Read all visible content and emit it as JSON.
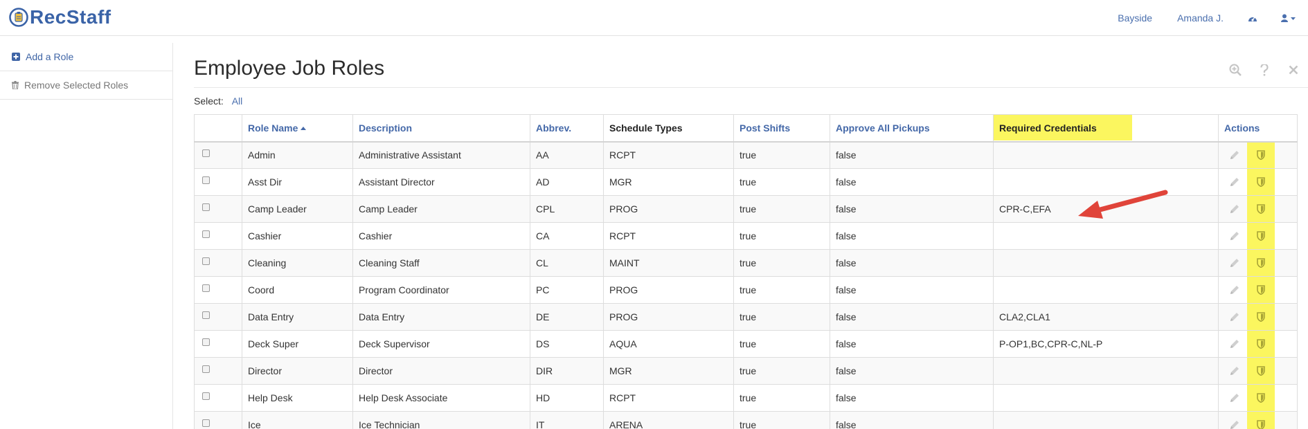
{
  "brand": {
    "name": "RecStaff"
  },
  "nav": {
    "location": "Bayside",
    "user": "Amanda J."
  },
  "sidebar": {
    "items": [
      {
        "label": "Add a Role",
        "icon": "plus-square-icon"
      },
      {
        "label": "Remove Selected Roles",
        "icon": "trash-icon"
      }
    ]
  },
  "page": {
    "title": "Employee Job Roles",
    "select_label": "Select:",
    "select_all": "All"
  },
  "table": {
    "columns": [
      "",
      "Role Name",
      "Description",
      "Abbrev.",
      "Schedule Types",
      "Post Shifts",
      "Approve All Pickups",
      "Required Credentials",
      "Actions"
    ],
    "rows": [
      [
        "Admin",
        "Administrative Assistant",
        "AA",
        "RCPT",
        "true",
        "false",
        ""
      ],
      [
        "Asst Dir",
        "Assistant Director",
        "AD",
        "MGR",
        "true",
        "false",
        ""
      ],
      [
        "Camp Leader",
        "Camp Leader",
        "CPL",
        "PROG",
        "true",
        "false",
        "CPR-C,EFA"
      ],
      [
        "Cashier",
        "Cashier",
        "CA",
        "RCPT",
        "true",
        "false",
        ""
      ],
      [
        "Cleaning",
        "Cleaning Staff",
        "CL",
        "MAINT",
        "true",
        "false",
        ""
      ],
      [
        "Coord",
        "Program Coordinator",
        "PC",
        "PROG",
        "true",
        "false",
        ""
      ],
      [
        "Data Entry",
        "Data Entry",
        "DE",
        "PROG",
        "true",
        "false",
        "CLA2,CLA1"
      ],
      [
        "Deck Super",
        "Deck Supervisor",
        "DS",
        "AQUA",
        "true",
        "false",
        "P-OP1,BC,CPR-C,NL-P"
      ],
      [
        "Director",
        "Director",
        "DIR",
        "MGR",
        "true",
        "false",
        ""
      ],
      [
        "Help Desk",
        "Help Desk Associate",
        "HD",
        "RCPT",
        "true",
        "false",
        ""
      ],
      [
        "Ice",
        "Ice Technician",
        "IT",
        "ARENA",
        "true",
        "false",
        ""
      ]
    ]
  },
  "colors": {
    "link": "#4468a8",
    "highlight": "#fbf65f",
    "annotation_arrow": "#e0443a"
  }
}
